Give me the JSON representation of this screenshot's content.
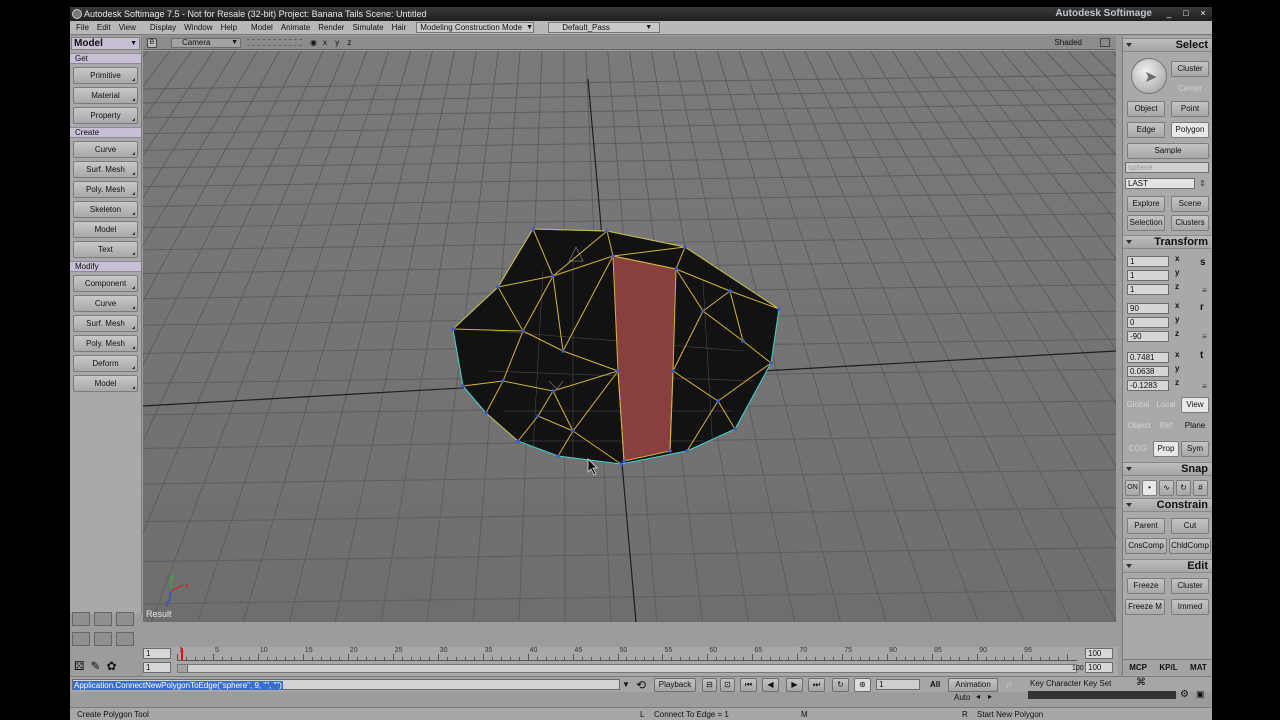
{
  "window": {
    "title": "Autodesk Softimage 7.5  -  Not for Resale (32-bit)    Project: Banana Tails    Scene: Untitled",
    "brand": "Autodesk Softimage",
    "min": "_",
    "max": "□",
    "close": "×"
  },
  "menu": {
    "items": [
      "File",
      "Edit",
      "View",
      "Display",
      "Window",
      "Help",
      "Model",
      "Animate",
      "Render",
      "Simulate",
      "Hair"
    ],
    "construction_mode": "Modeling Construction Mode",
    "render_pass": "Default_Pass"
  },
  "left_panel": {
    "mode": "Model",
    "get_label": "Get",
    "get_items": [
      "Primitive",
      "Material",
      "Property"
    ],
    "create_label": "Create",
    "create_items": [
      "Curve",
      "Surf. Mesh",
      "Poly. Mesh",
      "Skeleton",
      "Model",
      "Text"
    ],
    "modify_label": "Modify",
    "modify_items": [
      "Component",
      "Curve",
      "Surf. Mesh",
      "Poly. Mesh",
      "Deform",
      "Model"
    ]
  },
  "viewport": {
    "badge": "B",
    "camera": "Camera",
    "axes": "x y z",
    "display_mode": "Shaded",
    "result_label": "Result",
    "axis_x": "x",
    "axis_y": "y",
    "axis_z": "z"
  },
  "right_panel": {
    "select": {
      "title": "Select",
      "cluster": "Cluster",
      "center": "Center",
      "object": "Object",
      "point": "Point",
      "edge": "Edge",
      "polygon": "Polygon",
      "sample": "Sample",
      "filter_value": "sphere",
      "last": "LAST",
      "explore": "Explore",
      "scene": "Scene",
      "selection": "Selection",
      "clusters": "Clusters"
    },
    "transform": {
      "title": "Transform",
      "scale": [
        "1",
        "1",
        "1"
      ],
      "rotate": [
        "90",
        "0",
        "-90"
      ],
      "translate": [
        "0.7481",
        "0.0638",
        "-0.1283"
      ],
      "s_label": "s",
      "r_label": "r",
      "t_label": "t",
      "global": "Global",
      "local": "Local",
      "view": "View",
      "object": "Object",
      "ref": "Ref",
      "plane": "Plane",
      "cog": "COG",
      "prop": "Prop",
      "sym": "Sym"
    },
    "snap": {
      "title": "Snap",
      "on": "ON"
    },
    "constrain": {
      "title": "Constrain",
      "parent": "Parent",
      "cut": "Cut",
      "cnscomp": "CnsComp",
      "chldcomp": "ChldComp"
    },
    "edit": {
      "title": "Edit",
      "freeze": "Freeze",
      "cluster": "Cluster",
      "freeze_m": "Freeze M",
      "immed": "Immed"
    },
    "tabs": [
      "MCP",
      "KP/L",
      "MAT"
    ]
  },
  "timeline": {
    "start_frame": "1",
    "end_frame": "100",
    "range_start": "1",
    "range_end": "100",
    "end_label_small": "100",
    "ticks": [
      "1",
      "5",
      "10",
      "15",
      "20",
      "25",
      "30",
      "35",
      "40",
      "45",
      "50",
      "55",
      "60",
      "65",
      "70",
      "75",
      "80",
      "85",
      "90",
      "95"
    ],
    "current_frame": "1",
    "playback": "Playback",
    "all": "All",
    "animation": "Animation",
    "auto": "Auto",
    "key_set": "Key Character Key Set"
  },
  "command": {
    "text": "Application.ConnectNewPolygonToEdge(\"sphere\", 9, \"\", \"\")"
  },
  "status": {
    "tool": "Create Polygon Tool",
    "l_key": "L",
    "l_action": "Connect To Edge = 1",
    "m_key": "M",
    "r_key": "R",
    "r_action": "Start New Polygon"
  }
}
